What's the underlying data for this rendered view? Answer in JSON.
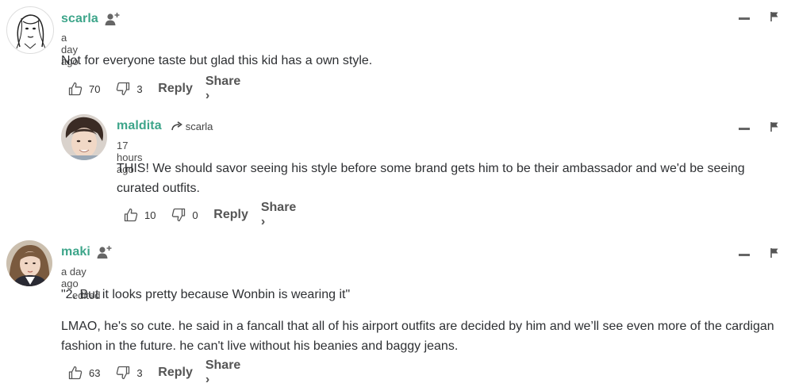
{
  "comments": [
    {
      "username": "scarla",
      "time": "a day ago",
      "paragraphs": [
        "Not for everyone taste but glad this kid has a own style."
      ],
      "likes": "70",
      "dislikes": "3",
      "reply_label": "Reply",
      "share_label": "Share ›",
      "icons": [
        "follow-icon",
        "collapse-icon",
        "flag-icon",
        "thumbs-up-icon",
        "thumbs-down-icon"
      ]
    },
    {
      "username": "maldita",
      "reply_to": "scarla",
      "time": "17 hours ago",
      "paragraphs": [
        "THIS! We should savor seeing his style before some brand gets him to be their ambassador and we'd be seeing curated outfits."
      ],
      "likes": "10",
      "dislikes": "0",
      "reply_label": "Reply",
      "share_label": "Share ›",
      "icons": [
        "reply-arrow-icon",
        "collapse-icon",
        "flag-icon",
        "thumbs-up-icon",
        "thumbs-down-icon"
      ]
    },
    {
      "username": "maki",
      "time": "a day ago",
      "edited": "edited",
      "paragraphs": [
        "\"2. But it looks pretty because Wonbin is wearing it\"",
        "LMAO, he's so cute. he said in a fancall that all of his airport outfits are decided by him and we’ll see even more of the cardigan fashion in the future. he can't live without his beanies and baggy jeans."
      ],
      "likes": "63",
      "dislikes": "3",
      "reply_label": "Reply",
      "share_label": "Share ›",
      "icons": [
        "follow-icon",
        "collapse-icon",
        "flag-icon",
        "thumbs-up-icon",
        "thumbs-down-icon"
      ]
    }
  ],
  "colors": {
    "username": "#3da58a",
    "text": "#2e3033",
    "muted": "#555555"
  }
}
